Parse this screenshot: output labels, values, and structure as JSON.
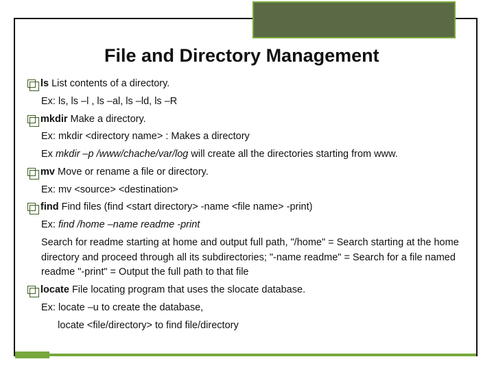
{
  "slide": {
    "title": "File and Directory Management",
    "items": [
      {
        "cmd": "ls",
        "desc": " List contents of a directory.",
        "sub": [
          {
            "text": "Ex: ls, ls –l , ls –al, ls –ld, ls –R"
          }
        ]
      },
      {
        "cmd": "mkdir",
        "desc": " Make a directory.",
        "sub": [
          {
            "text": "Ex: mkdir <directory name> : Makes a directory"
          },
          {
            "prefix": "Ex ",
            "italic": "mkdir –p /www/chache/var/log",
            "suffix": " will create all the directories starting from www."
          }
        ]
      },
      {
        "cmd": "mv",
        "desc": " Move or rename a file or directory.",
        "sub": [
          {
            "text": "Ex: mv <source> <destination>"
          }
        ]
      },
      {
        "cmd": "find",
        "desc": " Find files (find <start directory> -name <file name> -print)",
        "sub": [
          {
            "prefix": "Ex: ",
            "italic": "find /home –name readme -print"
          },
          {
            "text": "Search for readme starting at home and output full path, \"/home\" = Search starting at the home directory and proceed through all its subdirectories; \"-name readme\" = Search for a file named readme \"-print\" = Output the full path to that file"
          }
        ]
      },
      {
        "cmd": "locate",
        "desc": " File locating program that uses the slocate database.",
        "sub": [
          {
            "text": "Ex: locate –u to create the database,"
          },
          {
            "text": "      locate <file/directory> to find file/directory"
          }
        ]
      }
    ]
  }
}
